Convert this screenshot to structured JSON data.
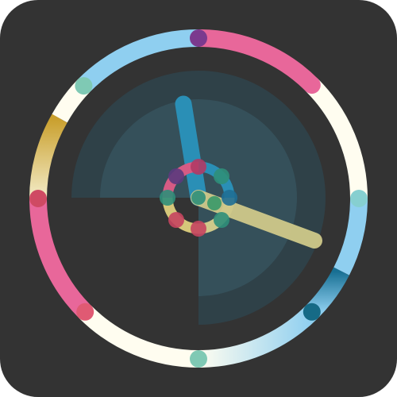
{
  "colors": {
    "background": "#ffffff",
    "tile": "#333333",
    "sector_outer": "#2f4148",
    "sector_inner": "#35505a",
    "hour_hand": "#2a8fb6",
    "minute_hand": "#cfc98a",
    "pink": "#e8679a",
    "light_blue": "#8fcff0",
    "white": "#fffdf0",
    "gold": "#cda53c",
    "dark_blue": "#1b7aa0"
  },
  "icons": [
    "clock-face-icon"
  ]
}
